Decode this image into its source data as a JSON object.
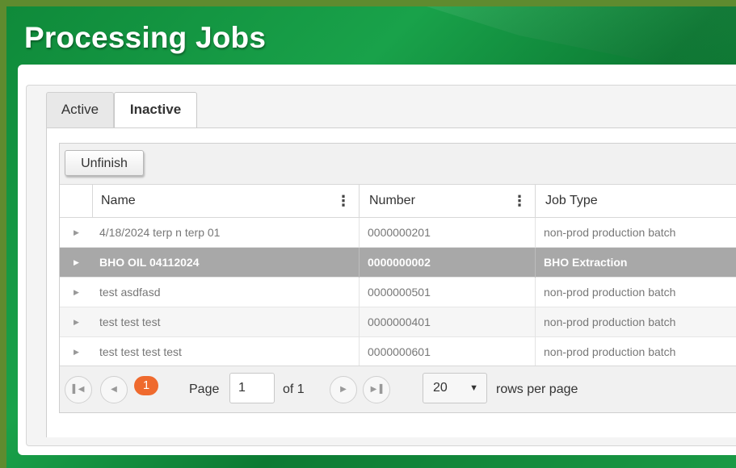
{
  "page": {
    "title": "Processing Jobs"
  },
  "tabs": [
    {
      "label": "Active",
      "selected": false
    },
    {
      "label": "Inactive",
      "selected": true
    }
  ],
  "toolbar": {
    "unfinish_label": "Unfinish"
  },
  "columns": [
    {
      "label": "Name",
      "menu_icon": "column-menu-icon"
    },
    {
      "label": "Number",
      "menu_icon": "column-menu-icon"
    },
    {
      "label": "Job Type"
    }
  ],
  "rows": [
    {
      "name": "4/18/2024 terp n terp 01",
      "number": "0000000201",
      "job_type": "non-prod production batch",
      "selected": false
    },
    {
      "name": "BHO OIL 04112024",
      "number": "0000000002",
      "job_type": "BHO Extraction",
      "selected": true
    },
    {
      "name": "test asdfasd",
      "number": "0000000501",
      "job_type": "non-prod production batch",
      "selected": false
    },
    {
      "name": "test test test",
      "number": "0000000401",
      "job_type": "non-prod production batch",
      "selected": false
    },
    {
      "name": "test test test test",
      "number": "0000000601",
      "job_type": "non-prod production batch",
      "selected": false
    }
  ],
  "pager": {
    "current_page_badge": "1",
    "page_label": "Page",
    "page_value": "1",
    "of_label": "of 1",
    "rows_per_page_value": "20",
    "rows_per_page_label": "rows per page"
  },
  "colors": {
    "brand_green": "#19a24a",
    "accent_orange": "#ef6a2e",
    "selected_row": "#a8a8a8"
  }
}
